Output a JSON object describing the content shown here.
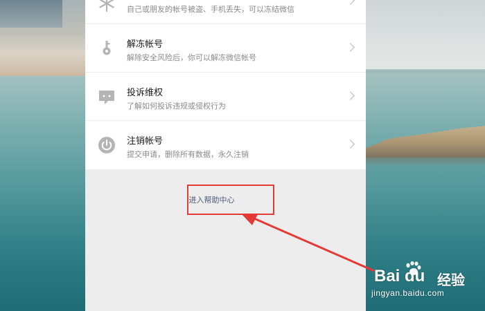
{
  "items": [
    {
      "title": "",
      "desc": "自己或朋友的帐号被盗、手机丢失，可以冻结微信",
      "icon": "snowflake-icon"
    },
    {
      "title": "解冻帐号",
      "desc": "解除安全风险后，你可以解冻微信帐号",
      "icon": "key-icon"
    },
    {
      "title": "投诉维权",
      "desc": "了解如何投诉违规或侵权行为",
      "icon": "chat-bubble-icon"
    },
    {
      "title": "注销帐号",
      "desc": "提交申请，删除所有数据，永久注销",
      "icon": "power-icon"
    }
  ],
  "help_link": "进入帮助中心",
  "watermark": {
    "brand": "Bai du",
    "product": "经验",
    "url": "jingyan.baidu.com"
  },
  "colors": {
    "annotation": "#e53935",
    "link": "#4d5a78",
    "icon": "#b4b4b4"
  }
}
